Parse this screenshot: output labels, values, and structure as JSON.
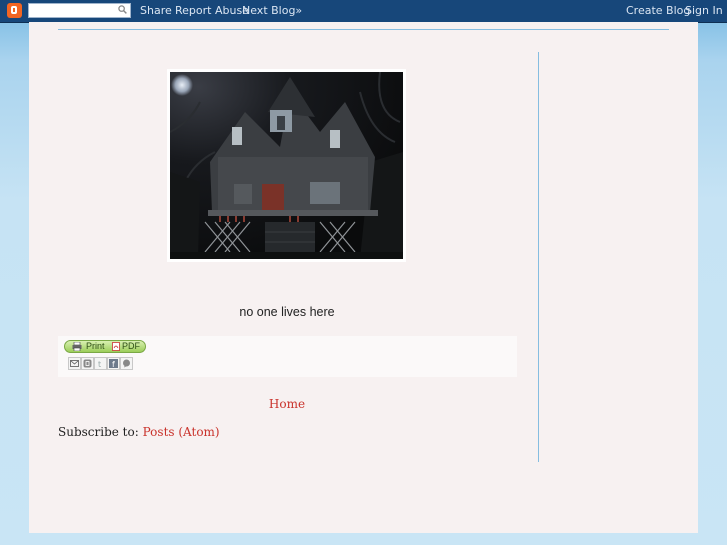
{
  "navbar": {
    "search_value": "",
    "links": {
      "share": "Share",
      "report_abuse": "Report Abuse",
      "next_blog": "Next Blog»",
      "create_blog": "Create Blog",
      "sign_in": "Sign In"
    }
  },
  "post": {
    "caption": "no one lives here"
  },
  "share_bar": {
    "print_label": "Print",
    "pdf_label": "PDF",
    "icons": [
      "email-icon",
      "blogthis-icon",
      "twitter-icon",
      "facebook-icon",
      "buzz-icon"
    ]
  },
  "footer": {
    "home_label": "Home",
    "subscribe_prefix": "Subscribe to: ",
    "subscribe_link": "Posts (Atom)"
  },
  "colors": {
    "navbar": "#17477a",
    "page_bg": "#f7f1f1",
    "link": "#c9322b",
    "rule": "#86bde0"
  }
}
